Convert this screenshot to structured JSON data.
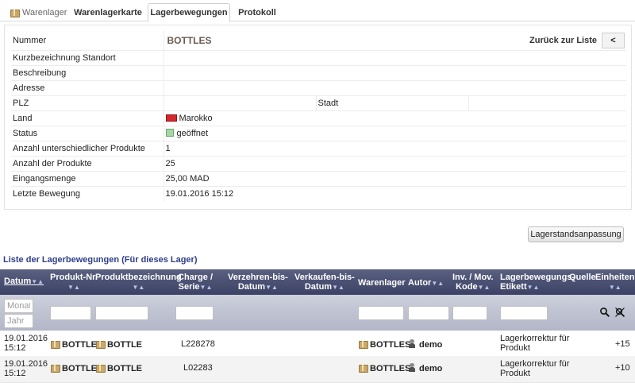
{
  "tabs": {
    "module": "Warenlager",
    "items": [
      "Warenlagerkarte",
      "Lagerbewegungen",
      "Protokoll"
    ]
  },
  "card": {
    "labels": {
      "nummer": "Nummer",
      "kurz": "Kurzbezeichnung Standort",
      "beschreibung": "Beschreibung",
      "adresse": "Adresse",
      "plz": "PLZ",
      "stadt": "Stadt",
      "land": "Land",
      "status": "Status",
      "anzahl_unterschiedlich": "Anzahl unterschiedlicher Produkte",
      "anzahl": "Anzahl der Produkte",
      "eingangsmenge": "Eingangsmenge",
      "letzte": "Letzte Bewegung"
    },
    "values": {
      "ref": "BOTTLES",
      "land": "Marokko",
      "status": "geöffnet",
      "anzahl_unterschiedlich": "1",
      "anzahl": "25",
      "eingangsmenge": "25,00 MAD",
      "letzte": "19.01.2016 15:12"
    },
    "back_label": "Zurück zur Liste",
    "back_button": "<"
  },
  "adjust_button": "Lagerstandsanpassung",
  "list": {
    "title": "Liste der Lagerbewegungen (Für dieses Lager)",
    "headers": {
      "datum": "Datum",
      "produkt_nr": "Produkt-Nr.",
      "produkt_bez": "Produktbezeichnung",
      "charge_1": "Charge /",
      "charge_2": "Serie",
      "verzehren_1": "Verzehren-bis-",
      "verzehren_2": "Datum",
      "verkaufen_1": "Verkaufen-bis-",
      "verkaufen_2": "Datum",
      "warenlager": "Warenlager",
      "autor": "Autor",
      "inv_1": "Inv. / Mov.",
      "inv_2": "Kode",
      "etikett_1": "Lagerbewegungs-",
      "etikett_2": "Etikett",
      "quelle": "Quelle",
      "einheiten": "Einheiten"
    },
    "filters": {
      "monat_placeholder": "Monat",
      "jahr_placeholder": "Jahr"
    },
    "rows": [
      {
        "datum_1": "19.01.2016",
        "datum_2": "15:12",
        "produkt_nr": "BOTTLE",
        "produkt_bez": "BOTTLE",
        "charge": "L228278",
        "warenlager": "BOTTLES",
        "autor": "demo",
        "etikett_1": "Lagerkorrektur für",
        "etikett_2": "Produkt",
        "einheiten": "+15"
      },
      {
        "datum_1": "19.01.2016",
        "datum_2": "15:12",
        "produkt_nr": "BOTTLE",
        "produkt_bez": "BOTTLE",
        "charge": "L02283",
        "warenlager": "BOTTLES",
        "autor": "demo",
        "etikett_1": "Lagerkorrektur für",
        "etikett_2": "Produkt",
        "einheiten": "+10"
      }
    ]
  },
  "colors": {
    "header_bg": "#4a5072",
    "filter_bg": "#c0c3d2",
    "list_title": "#2f3e8a",
    "ref_text": "#6a5a52",
    "flag_red": "#d2282e",
    "status_green": "#a8d5a8"
  },
  "icons": [
    "box-icon",
    "flag-icon",
    "status-icon",
    "search-icon",
    "clear-filter-icon",
    "user-icon",
    "sort-arrow-icon"
  ]
}
